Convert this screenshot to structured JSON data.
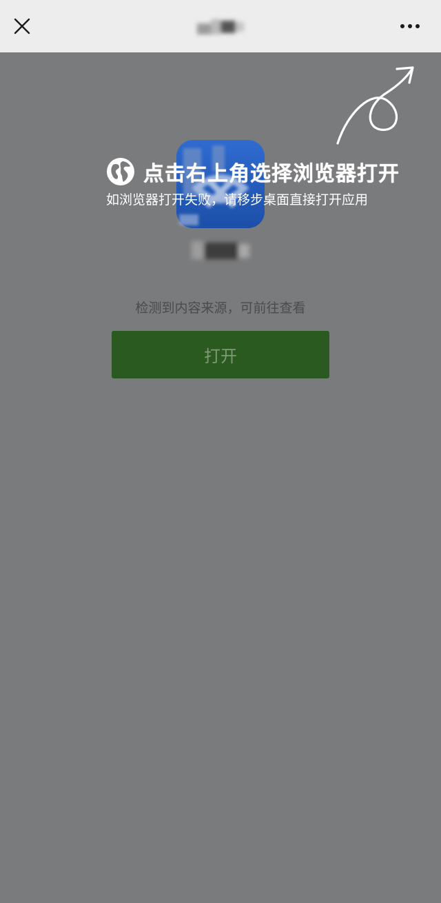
{
  "navbar": {
    "close_icon": "close-icon",
    "more_icon": "more-dots-icon",
    "background": "#ededed"
  },
  "app": {
    "logo_colors": [
      "#2f6bd1",
      "#1c4fa8"
    ]
  },
  "content": {
    "source_text": "检测到内容来源，可前往查看",
    "open_button_label": "打开",
    "button_color": "#2a5a20"
  },
  "overlay": {
    "title": "点击右上角选择浏览器打开",
    "subtitle": "如浏览器打开失败，请移步桌面直接打开应用",
    "globe_icon": "globe-icon",
    "arrow_icon": "curved-arrow-icon",
    "dim_color": "#7a7b7d"
  }
}
